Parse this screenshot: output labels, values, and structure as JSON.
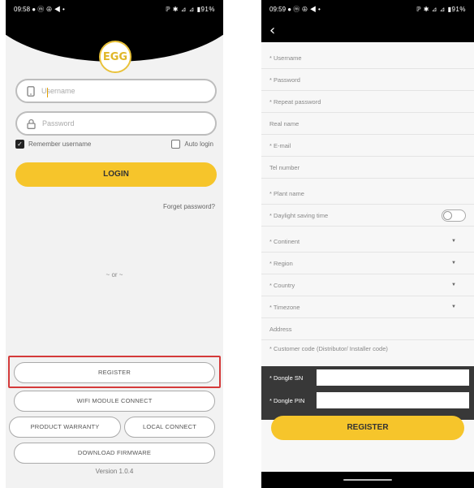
{
  "left_screen": {
    "status": {
      "time": "09:58 ● ⓜ ⊕ ◀ •",
      "right": "ℙ ✱ ⊿ ⊿ ▮91%"
    },
    "logo_text": "EGG",
    "username_placeholder": "Username",
    "password_placeholder": "Password",
    "remember_label": "Remember username",
    "remember_checked": true,
    "autologin_label": "Auto login",
    "autologin_checked": false,
    "login_label": "LOGIN",
    "forgot_label": "Forget password?",
    "or_label": "~ or ~",
    "register_label": "REGISTER",
    "wifi_label": "WIFI MODULE CONNECT",
    "warranty_label": "PRODUCT WARRANTY",
    "local_label": "LOCAL CONNECT",
    "download_label": "DOWNLOAD FIRMWARE",
    "version": "Version 1.0.4",
    "colors": {
      "accent": "#f6c52b",
      "highlight": "#d43a3a"
    }
  },
  "right_screen": {
    "status": {
      "time": "09:59 ● ⓜ ⊕ ◀ •",
      "right": "ℙ ✱ ⊿ ⊿ ▮91%"
    },
    "back_icon": "‹",
    "fields": {
      "username": "* Username",
      "password": "* Password",
      "repeat_password": "* Repeat password",
      "real_name": "Real name",
      "email": "* E-mail",
      "tel": "Tel number",
      "plant_name": "* Plant name",
      "daylight": "* Daylight saving time",
      "continent": "* Continent",
      "region": "* Region",
      "country": "* Country",
      "timezone": "* Timezone",
      "address": "Address",
      "customer_code": "* Customer code (Distributor/ Installer code)"
    },
    "dropdown_icon": "▼",
    "daylight_toggle": false,
    "dongle_sn_label": "* Dongle SN",
    "dongle_pin_label": "* Dongle PIN",
    "submit_label": "REGISTER"
  }
}
